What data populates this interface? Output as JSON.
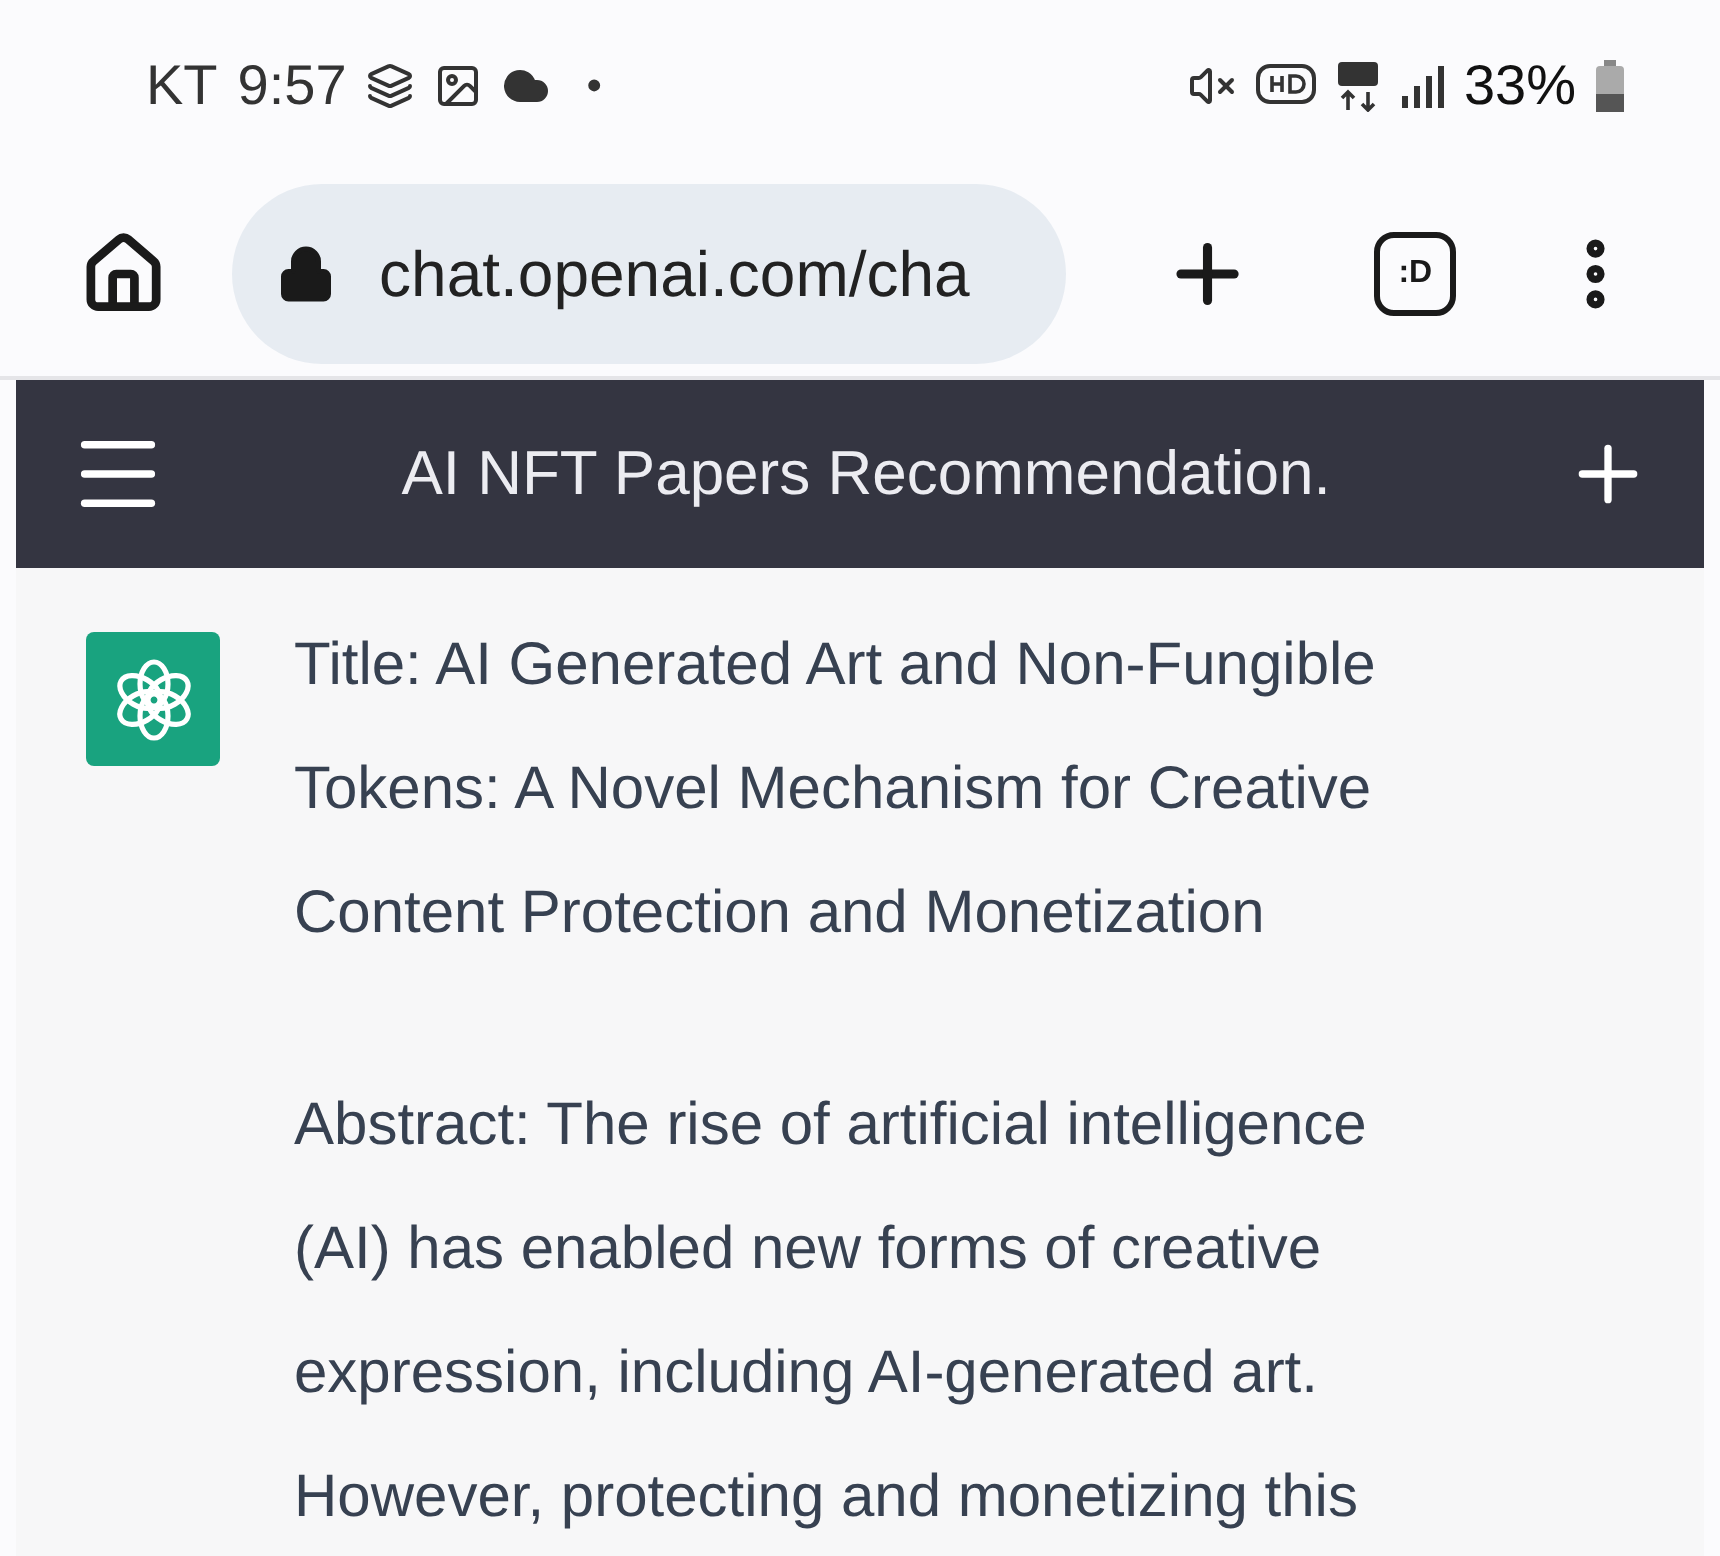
{
  "status_bar": {
    "carrier": "KT",
    "time": "9:57",
    "dot": "•",
    "battery": "33%"
  },
  "browser": {
    "url": "chat.openai.com/cha",
    "tab_label": ":D"
  },
  "header": {
    "title": "AI NFT Papers Recommendation."
  },
  "message": {
    "paragraphs": [
      [
        "Title: AI Generated Art and Non-Fungible",
        "Tokens: A Novel Mechanism for Creative",
        "Content Protection and Monetization"
      ],
      [
        "Abstract: The rise of artificial intelligence",
        "(AI) has enabled new forms of creative",
        "expression, including AI-generated art.",
        "However, protecting and monetizing this"
      ]
    ]
  }
}
